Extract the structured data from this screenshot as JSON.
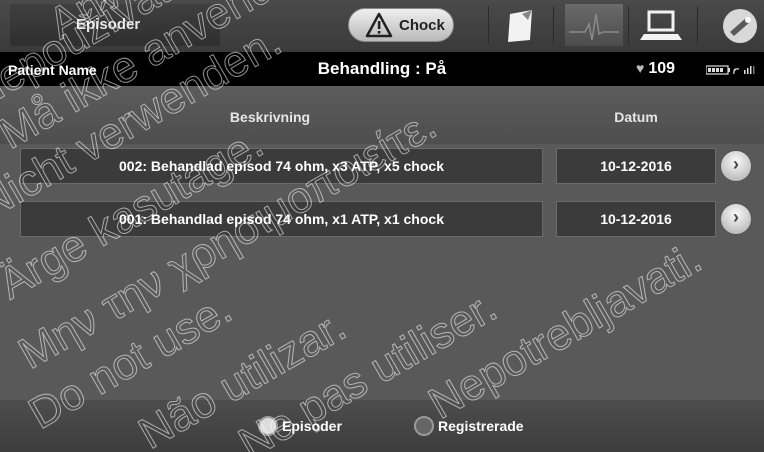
{
  "topbar": {
    "tab_label": "Episoder",
    "shock_label": "Chock",
    "nav_icons": [
      "notes-icon",
      "ecg-icon",
      "laptop-icon",
      "wand-icon"
    ]
  },
  "status": {
    "patient_name": "Patient Name",
    "therapy": "Behandling : På",
    "heart_rate": "109"
  },
  "table": {
    "col_description": "Beskrivning",
    "col_date": "Datum",
    "rows": [
      {
        "description": "002: Behandlad episod 74 ohm, x3 ATP, x5 chock",
        "date": "10-12-2016"
      },
      {
        "description": "001: Behandlad episod 74 ohm, x1 ATP, x1 chock",
        "date": "10-12-2016"
      }
    ]
  },
  "bottom": {
    "option1_label": "Episoder",
    "option2_label": "Registrerade",
    "selected": "Episoder"
  },
  "watermark_lines": [
    "Använd ej.",
    "Må ikke anvendes.",
    "Nicht verwenden.",
    "Ärge kasutage.",
    "Μην την χρησιμοποιείτε.",
    "Do not use.",
    "Não utilizar.",
    "Ne pas utiliser.",
    "Nepoužívat.",
    "Nepotrebljavati."
  ]
}
